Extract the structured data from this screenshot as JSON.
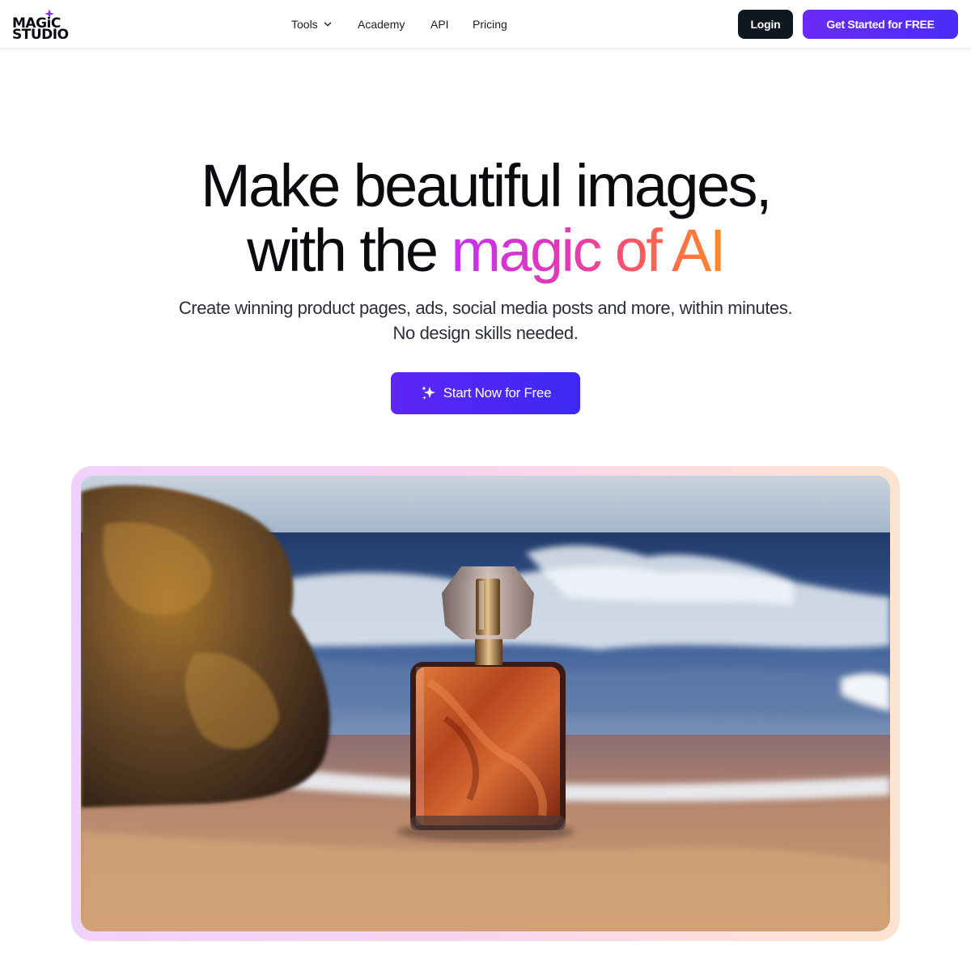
{
  "header": {
    "logo_line1": "MAGiC",
    "logo_line2": "STUDIO",
    "nav": {
      "tools": "Tools",
      "academy": "Academy",
      "api": "API",
      "pricing": "Pricing"
    },
    "login_label": "Login",
    "get_started_label": "Get Started for FREE"
  },
  "hero": {
    "headline_line1": "Make beautiful images,",
    "headline_line2_plain": "with the ",
    "headline_line2_gradient": "magic of AI",
    "subtitle_line1": "Create winning product pages, ads, social media posts and more, within minutes.",
    "subtitle_line2": "No design skills needed.",
    "cta_label": "Start Now for Free"
  },
  "icons": {
    "logo_spark": "sparkle-icon",
    "tools_dropdown": "chevron-down-icon",
    "cta": "sparkles-icon"
  },
  "colors": {
    "brand_purple": "#5a2bf7",
    "login_dark": "#0f1720",
    "gradient_start": "#c62ff2",
    "gradient_end": "#ff8a2a"
  }
}
